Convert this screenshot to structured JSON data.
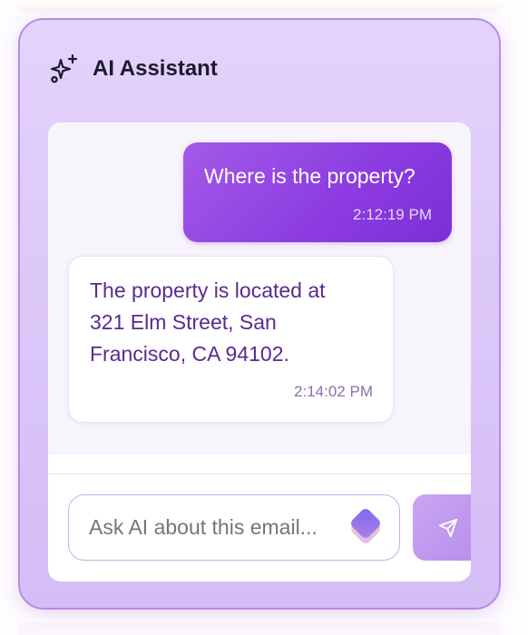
{
  "header": {
    "title": "AI Assistant",
    "icon": "sparkles-icon"
  },
  "messages": [
    {
      "role": "user",
      "text": "Where is the property?",
      "time": "2:12:19 PM"
    },
    {
      "role": "assistant",
      "lines": [
        "The property is located at",
        "321 Elm Street, San",
        "Francisco, CA 94102."
      ],
      "time": "2:14:02 PM"
    }
  ],
  "input": {
    "placeholder": "Ask AI about this email...",
    "value": ""
  },
  "send_button": {
    "icon": "send-icon"
  },
  "colors": {
    "accent": "#8b3be0",
    "panel_border": "#b98ae6",
    "assistant_text": "#5a2a8e"
  }
}
